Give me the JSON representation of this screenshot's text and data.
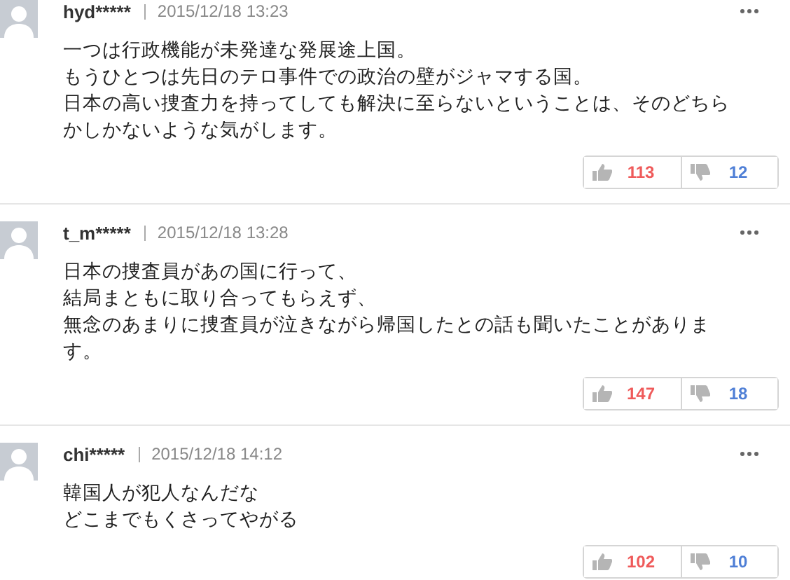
{
  "comments": [
    {
      "user": "hyd*****",
      "date": "2015/12/18 13:23",
      "lines": [
        "一つは行政機能が未発達な発展途上国。",
        "もうひとつは先日のテロ事件での政治の壁がジャマする国。",
        "日本の高い捜査力を持ってしても解決に至らないということは、そのどちら",
        "かしかないような気がします。"
      ],
      "good": "113",
      "bad": "12"
    },
    {
      "user": "t_m*****",
      "date": "2015/12/18 13:28",
      "lines": [
        "日本の捜査員があの国に行って、",
        "結局まともに取り合ってもらえず、",
        "無念のあまりに捜査員が泣きながら帰国したとの話も聞いたことがありま",
        "す。"
      ],
      "good": "147",
      "bad": "18"
    },
    {
      "user": "chi*****",
      "date": "2015/12/18 14:12",
      "lines": [
        "韓国人が犯人なんだな",
        "どこまでもくさってやがる"
      ],
      "good": "102",
      "bad": "10"
    }
  ]
}
